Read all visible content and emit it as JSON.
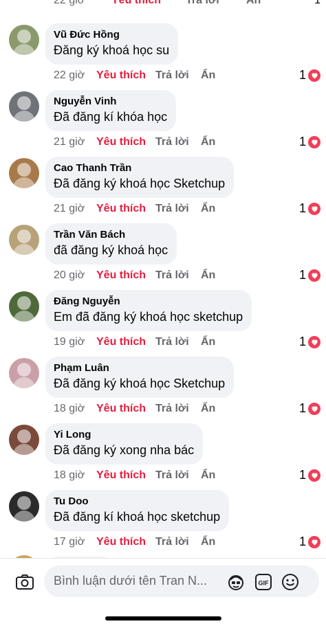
{
  "top_partial": {
    "time": "22 giờ",
    "like": "Yêu thích",
    "reply": "Trả lời",
    "hide": "Ẩn",
    "count": "1"
  },
  "comments": [
    {
      "author": "Vũ Đức Hồng",
      "text": "Đăng ký khoá học su",
      "time": "22 giờ",
      "like": "Yêu thích",
      "reply": "Trả lời",
      "hide": "Ẩn",
      "count": "1",
      "avatar_color": "#8a9a6b"
    },
    {
      "author": "Nguyễn Vinh",
      "text": "Đã đăng kí khóa học",
      "time": "21 giờ",
      "like": "Yêu thích",
      "reply": "Trả lời",
      "hide": "Ẩn",
      "count": "1",
      "avatar_color": "#6f7378"
    },
    {
      "author": "Cao Thanh Trần",
      "text": "Đã đăng ký khoá học Sketchup",
      "time": "21 giờ",
      "like": "Yêu thích",
      "reply": "Trả lời",
      "hide": "Ẩn",
      "count": "1",
      "avatar_color": "#a87a4a"
    },
    {
      "author": "Trần Văn Bách",
      "text": "đã đăng ký khoá học",
      "time": "20 giờ",
      "like": "Yêu thích",
      "reply": "Trả lời",
      "hide": "Ẩn",
      "count": "1",
      "avatar_color": "#b7a27a"
    },
    {
      "author": "Đăng Nguyễn",
      "text": "Em đã đăng ký khoá học sketchup",
      "time": "19 giờ",
      "like": "Yêu thích",
      "reply": "Trả lời",
      "hide": "Ẩn",
      "count": "1",
      "avatar_color": "#4e6a3a"
    },
    {
      "author": "Phạm Luân",
      "text": "Đã đăng ký khoá học Sketchup",
      "time": "18 giờ",
      "like": "Yêu thích",
      "reply": "Trả lời",
      "hide": "Ẩn",
      "count": "1",
      "avatar_color": "#c9a0a8"
    },
    {
      "author": "Yi Long",
      "text": "Đã đăng ký xong nha bác",
      "time": "18 giờ",
      "like": "Yêu thích",
      "reply": "Trả lời",
      "hide": "Ẩn",
      "count": "1",
      "avatar_color": "#7a4a3a"
    },
    {
      "author": "Tu Doo",
      "text": "Đã đăng kí khoá học sketchup",
      "time": "17 giờ",
      "like": "Yêu thích",
      "reply": "Trả lời",
      "hide": "Ẩn",
      "count": "1",
      "avatar_color": "#2a2a2a"
    }
  ],
  "composer": {
    "placeholder": "Bình luận dưới tên Tran N...",
    "icons": [
      "camera-icon",
      "avatar-sticker-icon",
      "gif-icon",
      "emoji-icon"
    ]
  },
  "colors": {
    "like": "#e41e3f",
    "bubble": "#f0f2f5",
    "meta": "#65676b",
    "heart": "#f33e58"
  }
}
